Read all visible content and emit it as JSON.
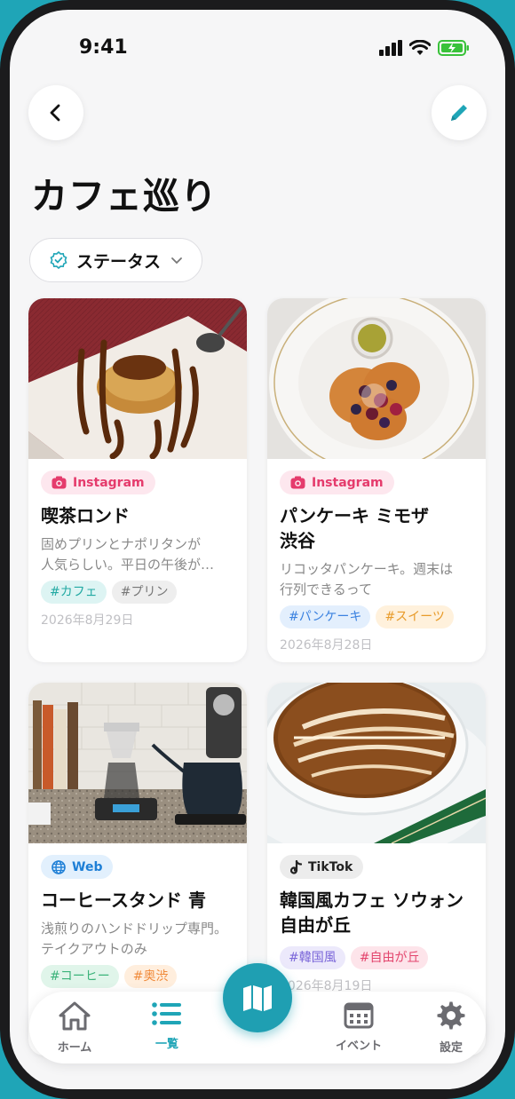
{
  "status_bar": {
    "time": "9:41"
  },
  "header": {
    "title": "カフェ巡り"
  },
  "filter": {
    "label": "ステータス"
  },
  "cards": [
    {
      "source": "Instagram",
      "title": "喫茶ロンド",
      "desc_line1": "固めプリンとナポリタンが",
      "desc_line2": "人気らしい。平日の午後が…",
      "tags": [
        "#カフェ",
        "#プリン"
      ],
      "date": "2026年8月29日"
    },
    {
      "source": "Instagram",
      "title_line1": "パンケーキ ミモザ",
      "title_line2": "渋谷",
      "desc_line1": "リコッタパンケーキ。週末は",
      "desc_line2": "行列できるって",
      "tags": [
        "#パンケーキ",
        "#スイーツ"
      ],
      "date": "2026年8月28日"
    },
    {
      "source": "Web",
      "title": "コーヒースタンド 青",
      "desc_line1": "浅煎りのハンドドリップ専門。",
      "desc_line2": "テイクアウトのみ",
      "tags": [
        "#コーヒー",
        "#奥渋"
      ]
    },
    {
      "source": "TikTok",
      "title_line1": "韓国風カフェ ソウォン",
      "title_line2": "自由が丘",
      "tags": [
        "#韓国風",
        "#自由が丘"
      ],
      "date": "2026年8月19日"
    }
  ],
  "nav": {
    "home": "ホーム",
    "list": "一覧",
    "event": "イベント",
    "settings": "設定"
  },
  "colors": {
    "accent": "#1fa5b7",
    "instagram": "#e53b6c",
    "web": "#1e7fd6"
  }
}
